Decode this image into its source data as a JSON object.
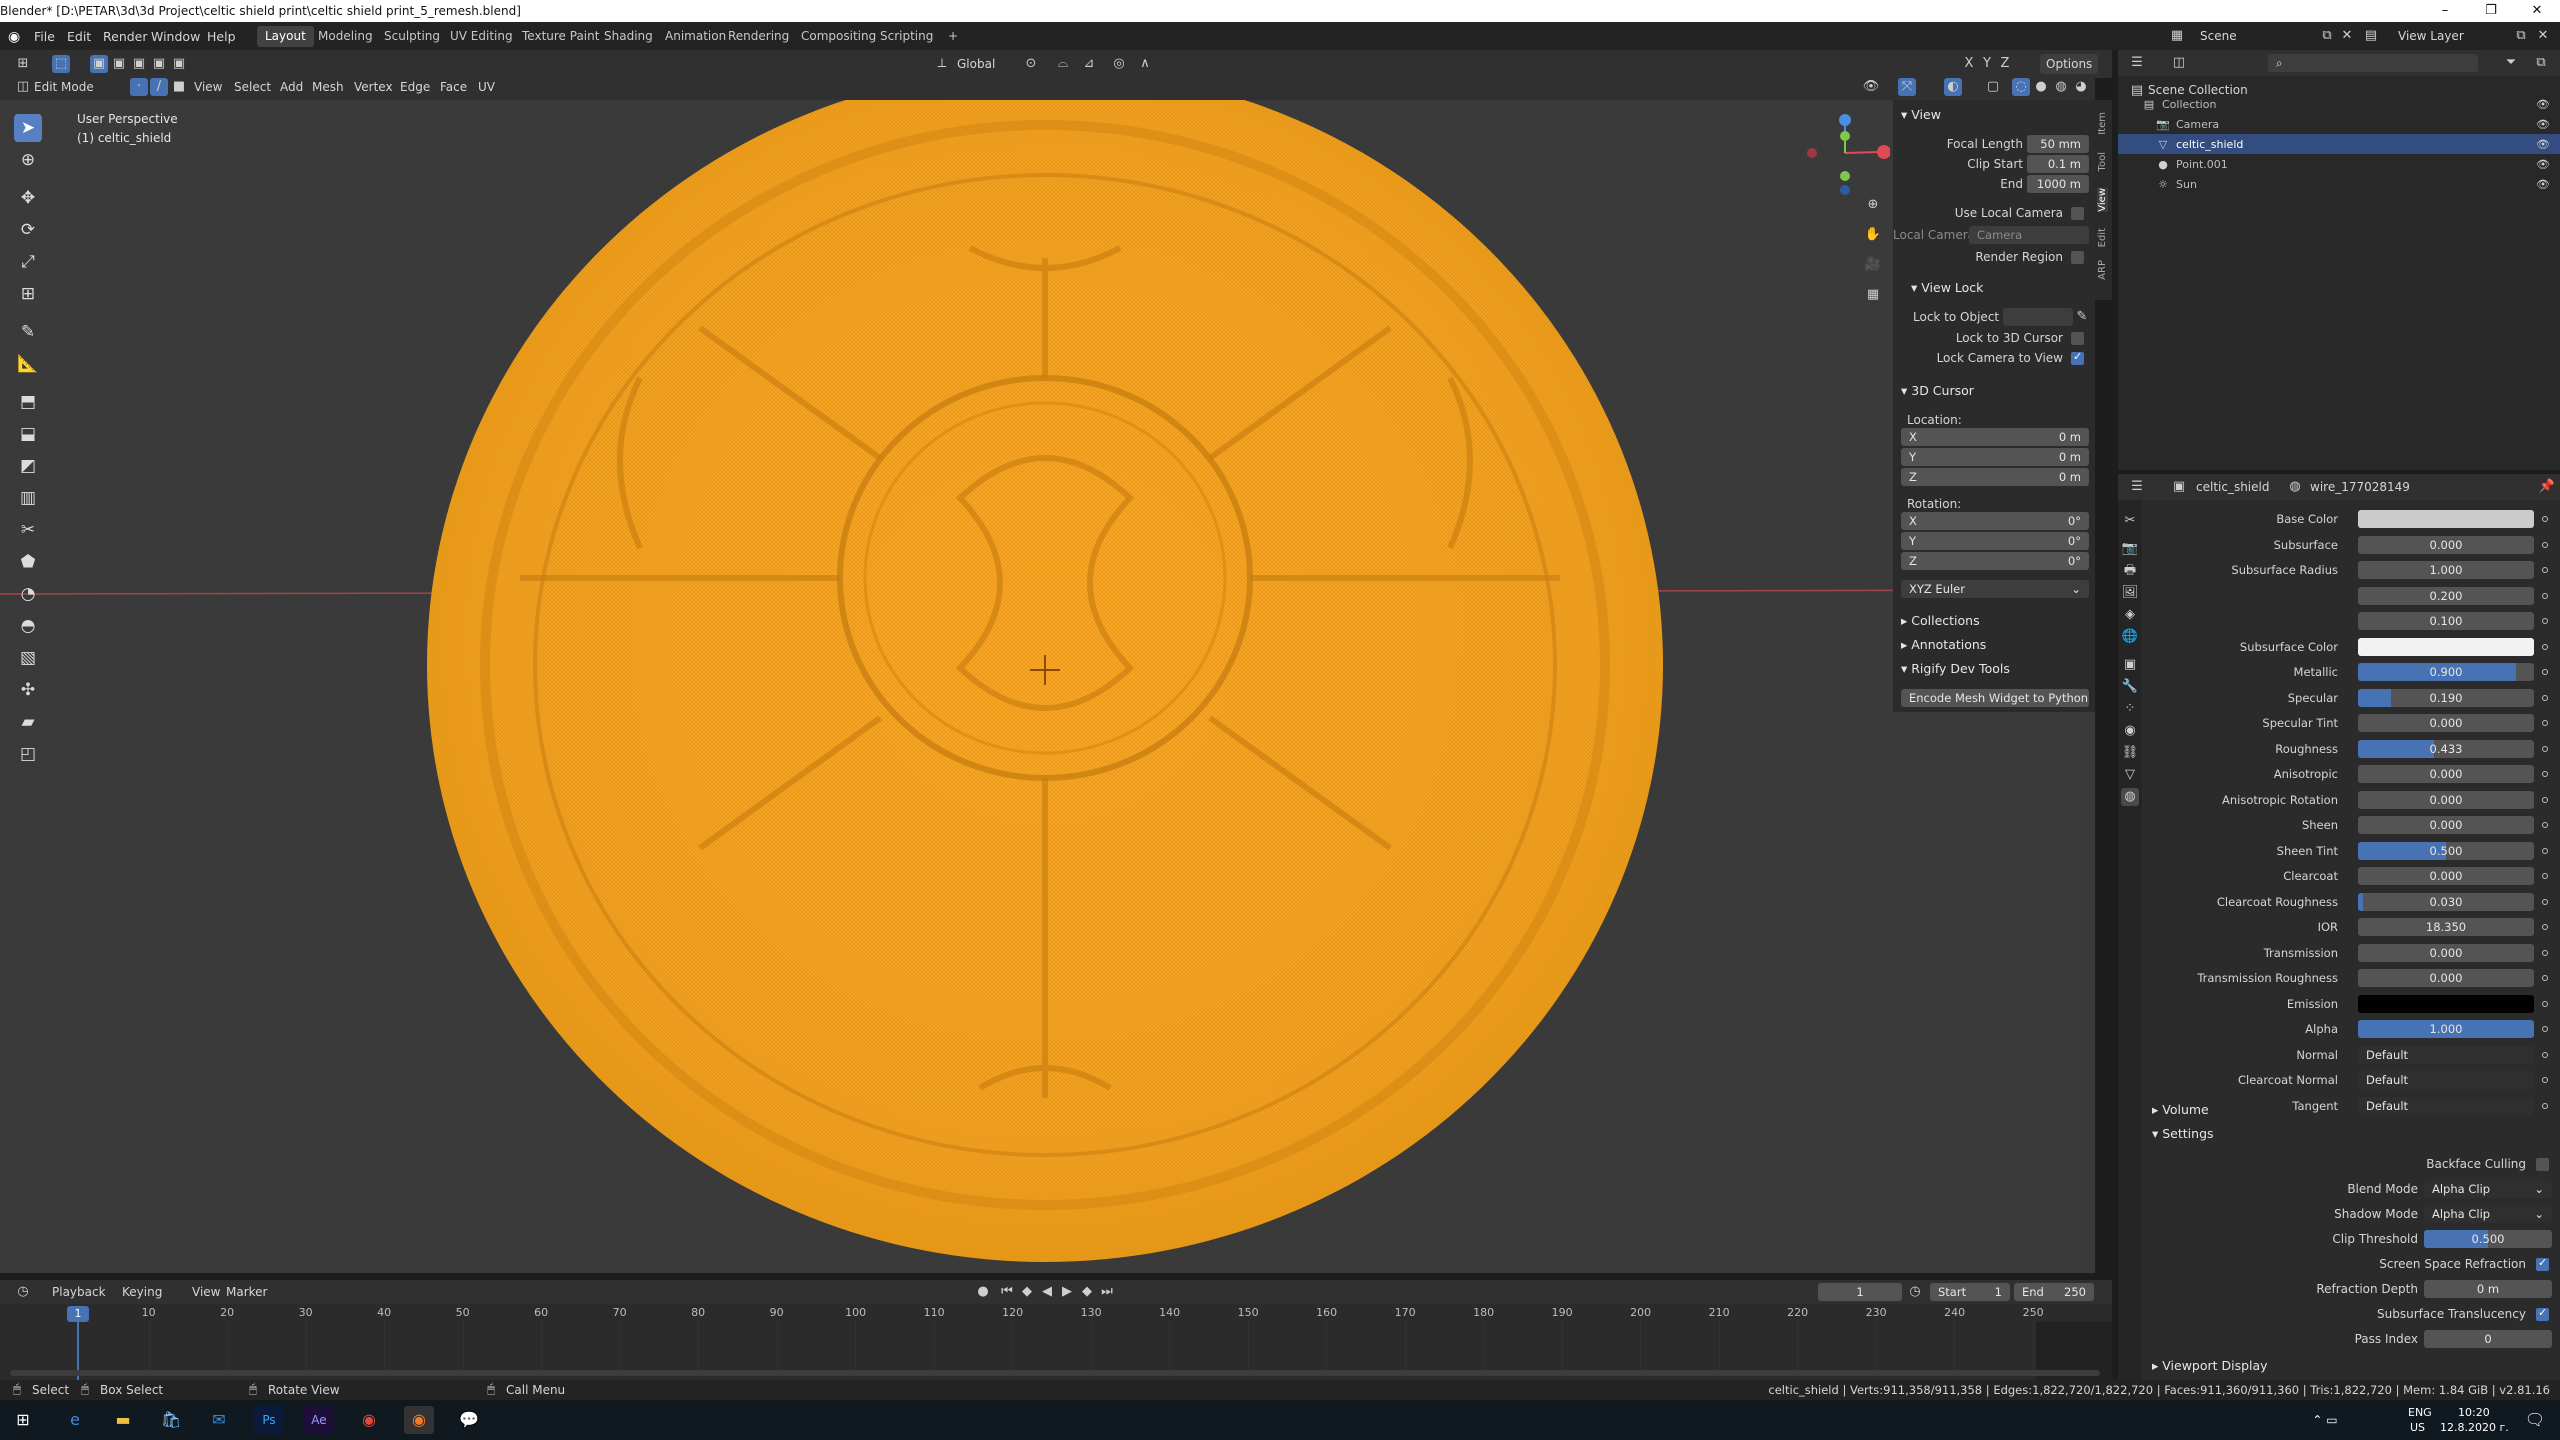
{
  "window": {
    "title": "Blender* [D:\\PETAR\\3d\\3d Project\\celtic shield print\\celtic shield print_5_remesh.blend]",
    "controls": [
      "–",
      "❐",
      "✕"
    ]
  },
  "menu": {
    "items": [
      "File",
      "Edit",
      "Render",
      "Window",
      "Help"
    ]
  },
  "workspaces": [
    "Layout",
    "Modeling",
    "Sculpting",
    "UV Editing",
    "Texture Paint",
    "Shading",
    "Animation",
    "Rendering",
    "Compositing",
    "Scripting",
    "+"
  ],
  "active_workspace": "Layout",
  "scene": {
    "label": "Scene",
    "view_layer": "View Layer"
  },
  "viewport_header": {
    "mode": "Edit Mode",
    "menus": [
      "View",
      "Select",
      "Add",
      "Mesh",
      "Vertex",
      "Edge",
      "Face",
      "UV"
    ],
    "transform_orientation": "Global",
    "options": "Options",
    "axes": [
      "X",
      "Y",
      "Z"
    ]
  },
  "viewport": {
    "perspective": "User Perspective",
    "object": "(1) celtic_shield",
    "shield_color": "#f0a020",
    "grid_color": "#3a3a3a"
  },
  "npanel": {
    "tabs": [
      "Item",
      "Tool",
      "View",
      "Edit",
      "ARP"
    ],
    "view": {
      "header": "View",
      "focal_length_label": "Focal Length",
      "focal_length": "50 mm",
      "clip_start_label": "Clip Start",
      "clip_start": "0.1 m",
      "end_label": "End",
      "end": "1000 m",
      "use_local_camera": "Use Local Camera",
      "local_camera_label": "Local Camera",
      "local_camera": "Camera",
      "render_region": "Render Region"
    },
    "view_lock": {
      "header": "View Lock",
      "lock_to_object": "Lock to Object",
      "lock_to_cursor": "Lock to 3D Cursor",
      "lock_camera": "Lock Camera to View"
    },
    "cursor": {
      "header": "3D Cursor",
      "location": "Location:",
      "loc": [
        {
          "axis": "X",
          "value": "0 m"
        },
        {
          "axis": "Y",
          "value": "0 m"
        },
        {
          "axis": "Z",
          "value": "0 m"
        }
      ],
      "rotation": "Rotation:",
      "rot": [
        {
          "axis": "X",
          "value": "0°"
        },
        {
          "axis": "Y",
          "value": "0°"
        },
        {
          "axis": "Z",
          "value": "0°"
        }
      ],
      "mode": "XYZ Euler"
    },
    "collections": "Collections",
    "annotations": "Annotations",
    "rigify": "Rigify Dev Tools",
    "encode_button": "Encode Mesh Widget to Python"
  },
  "outliner": {
    "root": "Scene Collection",
    "items": [
      {
        "name": "Collection",
        "selected": false
      },
      {
        "name": "Camera",
        "selected": false
      },
      {
        "name": "celtic_shield",
        "selected": true
      },
      {
        "name": "Point.001",
        "selected": false
      },
      {
        "name": "Sun",
        "selected": false
      }
    ]
  },
  "properties": {
    "object": "celtic_shield",
    "material": "wire_177028149",
    "rows": [
      {
        "label": "Base Color",
        "type": "color",
        "color": "#cccccc"
      },
      {
        "label": "Subsurface",
        "type": "value",
        "value": "0.000",
        "fill": 0
      },
      {
        "label": "Subsurface Radius",
        "type": "value",
        "value": "1.000",
        "fill": 0
      },
      {
        "label": "",
        "type": "value",
        "value": "0.200",
        "fill": 0
      },
      {
        "label": "",
        "type": "value",
        "value": "0.100",
        "fill": 0
      },
      {
        "label": "Subsurface Color",
        "type": "color",
        "color": "#f2f2f2"
      },
      {
        "label": "Metallic",
        "type": "value",
        "value": "0.900",
        "fill": 0.9
      },
      {
        "label": "Specular",
        "type": "value",
        "value": "0.190",
        "fill": 0.19
      },
      {
        "label": "Specular Tint",
        "type": "value",
        "value": "0.000",
        "fill": 0
      },
      {
        "label": "Roughness",
        "type": "value",
        "value": "0.433",
        "fill": 0.433
      },
      {
        "label": "Anisotropic",
        "type": "value",
        "value": "0.000",
        "fill": 0
      },
      {
        "label": "Anisotropic Rotation",
        "type": "value",
        "value": "0.000",
        "fill": 0
      },
      {
        "label": "Sheen",
        "type": "value",
        "value": "0.000",
        "fill": 0
      },
      {
        "label": "Sheen Tint",
        "type": "value",
        "value": "0.500",
        "fill": 0.5
      },
      {
        "label": "Clearcoat",
        "type": "value",
        "value": "0.000",
        "fill": 0
      },
      {
        "label": "Clearcoat Roughness",
        "type": "value",
        "value": "0.030",
        "fill": 0.03
      },
      {
        "label": "IOR",
        "type": "value",
        "value": "18.350",
        "fill": 0
      },
      {
        "label": "Transmission",
        "type": "value",
        "value": "0.000",
        "fill": 0
      },
      {
        "label": "Transmission Roughness",
        "type": "value",
        "value": "0.000",
        "fill": 0
      },
      {
        "label": "Emission",
        "type": "color",
        "color": "#000000"
      },
      {
        "label": "Alpha",
        "type": "value",
        "value": "1.000",
        "fill": 1
      },
      {
        "label": "Normal",
        "type": "text",
        "value": "Default"
      },
      {
        "label": "Clearcoat Normal",
        "type": "text",
        "value": "Default"
      },
      {
        "label": "Tangent",
        "type": "text",
        "value": "Default"
      }
    ],
    "volume": "Volume",
    "settings": "Settings",
    "backface_culling": "Backface Culling",
    "blend_mode_label": "Blend Mode",
    "blend_mode": "Alpha Clip",
    "shadow_mode_label": "Shadow Mode",
    "shadow_mode": "Alpha Clip",
    "clip_threshold_label": "Clip Threshold",
    "clip_threshold": "0.500",
    "clip_threshold_fill": 0.5,
    "ssr": "Screen Space Refraction",
    "refraction_depth_label": "Refraction Depth",
    "refraction_depth": "0 m",
    "sss_translucency": "Subsurface Translucency",
    "pass_index_label": "Pass Index",
    "pass_index": "0",
    "viewport_display": "Viewport Display"
  },
  "timeline": {
    "menus": [
      "Playback",
      "Keying",
      "View",
      "Marker"
    ],
    "current_frame": "1",
    "start_label": "Start",
    "start": "1",
    "end_label": "End",
    "end": "250",
    "ticks": [
      "1",
      "10",
      "20",
      "30",
      "40",
      "50",
      "60",
      "70",
      "80",
      "90",
      "100",
      "110",
      "120",
      "130",
      "140",
      "150",
      "160",
      "170",
      "180",
      "190",
      "200",
      "210",
      "220",
      "230",
      "240",
      "250"
    ]
  },
  "statusbar": {
    "select": "Select",
    "box_select": "Box Select",
    "rotate_view": "Rotate View",
    "call_menu": "Call Menu",
    "stats": "celtic_shield | Verts:911,358/911,358 | Edges:1,822,720/1,822,720 | Faces:911,360/911,360 | Tris:1,822,720 | Mem: 1.84 GiB | v2.81.16"
  },
  "taskbar": {
    "lang": "ENG",
    "region": "US",
    "time": "10:20",
    "date": "12.8.2020 г."
  }
}
